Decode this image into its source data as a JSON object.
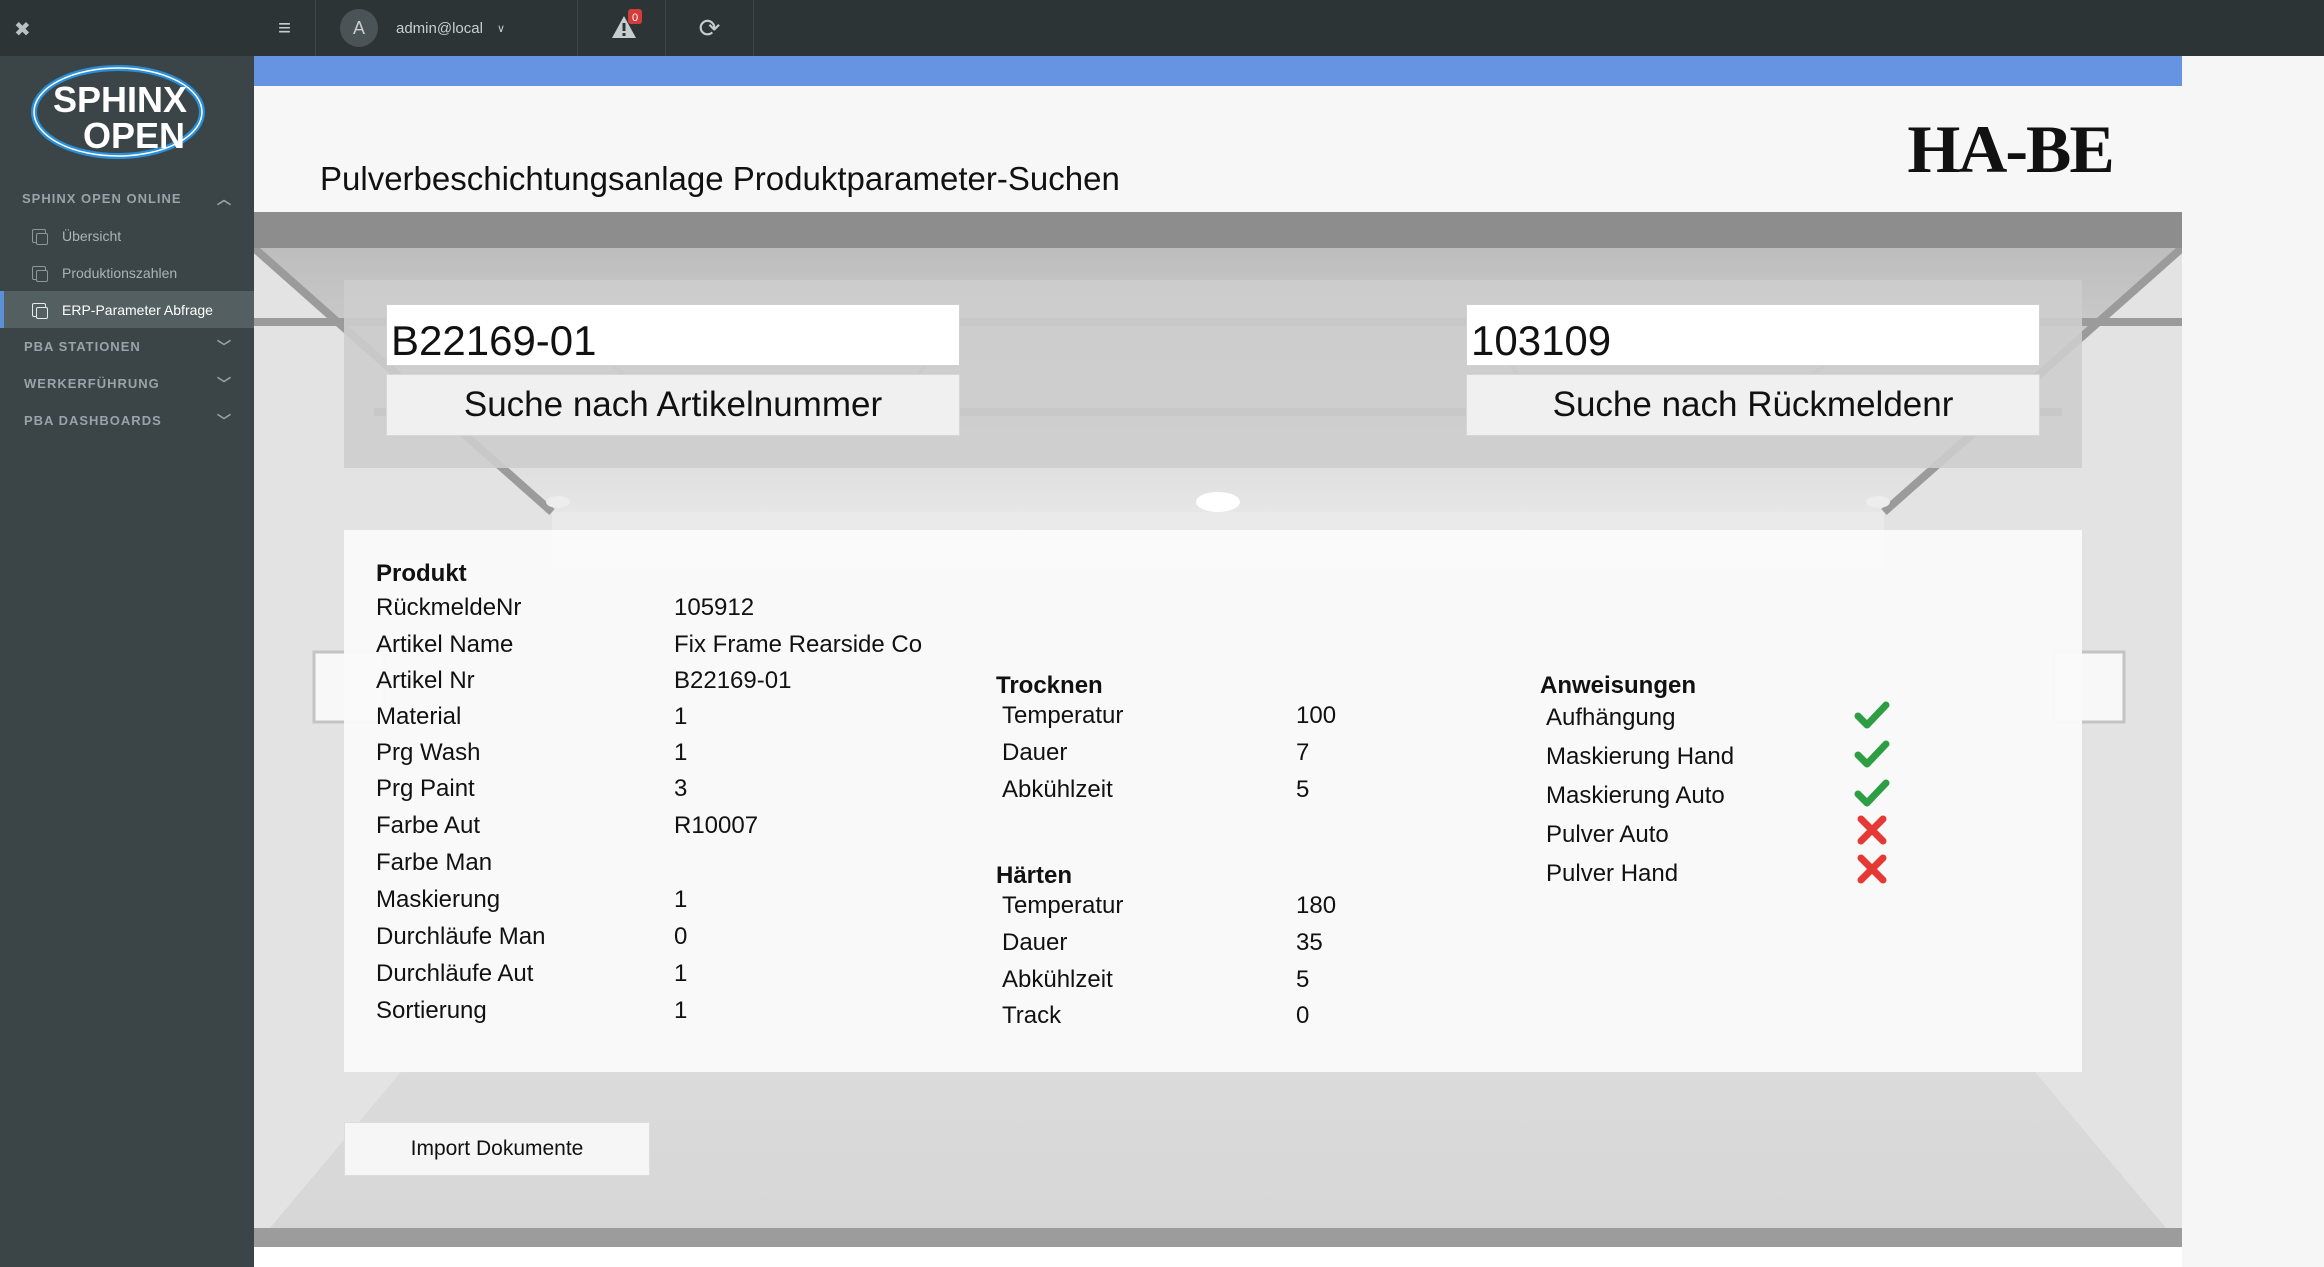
{
  "app": {
    "logo_text_top": "SPHINX",
    "logo_text_bottom": "OPEN",
    "brand_logo": "HA-BE"
  },
  "topbar": {
    "user_initial": "A",
    "user_name": "admin@local",
    "alert_count": "0"
  },
  "sidebar": {
    "section_online": "SPHINX OPEN ONLINE",
    "items": [
      {
        "label": "Übersicht"
      },
      {
        "label": "Produktionszahlen"
      },
      {
        "label": "ERP-Parameter Abfrage"
      }
    ],
    "sections": [
      {
        "label": "PBA STATIONEN"
      },
      {
        "label": "WERKERFÜHRUNG"
      },
      {
        "label": "PBA DASHBOARDS"
      }
    ]
  },
  "page": {
    "title": "Pulverbeschichtungsanlage Produktparameter-Suchen"
  },
  "search": {
    "artikel_value": "B22169-01",
    "artikel_button": "Suche nach Artikelnummer",
    "rueckmelde_value": "103109",
    "rueckmelde_button": "Suche nach Rückmeldenr"
  },
  "produkt": {
    "title": "Produkt",
    "rows": [
      {
        "label": "RückmeldeNr",
        "value": "105912"
      },
      {
        "label": "Artikel Name",
        "value": "Fix Frame Rearside Co"
      },
      {
        "label": "Artikel Nr",
        "value": "B22169-01"
      },
      {
        "label": "Material",
        "value": "1"
      },
      {
        "label": "Prg Wash",
        "value": "1"
      },
      {
        "label": "Prg Paint",
        "value": "3"
      },
      {
        "label": "Farbe Aut",
        "value": "R10007"
      },
      {
        "label": "Farbe Man",
        "value": ""
      },
      {
        "label": "Maskierung",
        "value": "1"
      },
      {
        "label": "Durchläufe Man",
        "value": "0"
      },
      {
        "label": "Durchläufe Aut",
        "value": "1"
      },
      {
        "label": "Sortierung",
        "value": "1"
      }
    ]
  },
  "trocknen": {
    "title": "Trocknen",
    "rows": [
      {
        "label": "Temperatur",
        "value": "100"
      },
      {
        "label": "Dauer",
        "value": "7"
      },
      {
        "label": "Abkühlzeit",
        "value": "5"
      }
    ]
  },
  "haerten": {
    "title": "Härten",
    "rows": [
      {
        "label": "Temperatur",
        "value": "180"
      },
      {
        "label": "Dauer",
        "value": "35"
      },
      {
        "label": "Abkühlzeit",
        "value": "5"
      },
      {
        "label": "Track",
        "value": "0"
      }
    ]
  },
  "anweisungen": {
    "title": "Anweisungen",
    "rows": [
      {
        "label": "Aufhängung",
        "status": "check"
      },
      {
        "label": "Maskierung Hand",
        "status": "check"
      },
      {
        "label": "Maskierung Auto",
        "status": "check"
      },
      {
        "label": "Pulver Auto",
        "status": "cross"
      },
      {
        "label": "Pulver Hand",
        "status": "cross"
      }
    ]
  },
  "actions": {
    "import_label": "Import Dokumente"
  },
  "colors": {
    "accent_blue": "#6693e2",
    "check_green": "#2e9e44",
    "cross_red": "#e53935",
    "sidebar_bg": "#3b4548",
    "topbar_bg": "#2d3436"
  }
}
